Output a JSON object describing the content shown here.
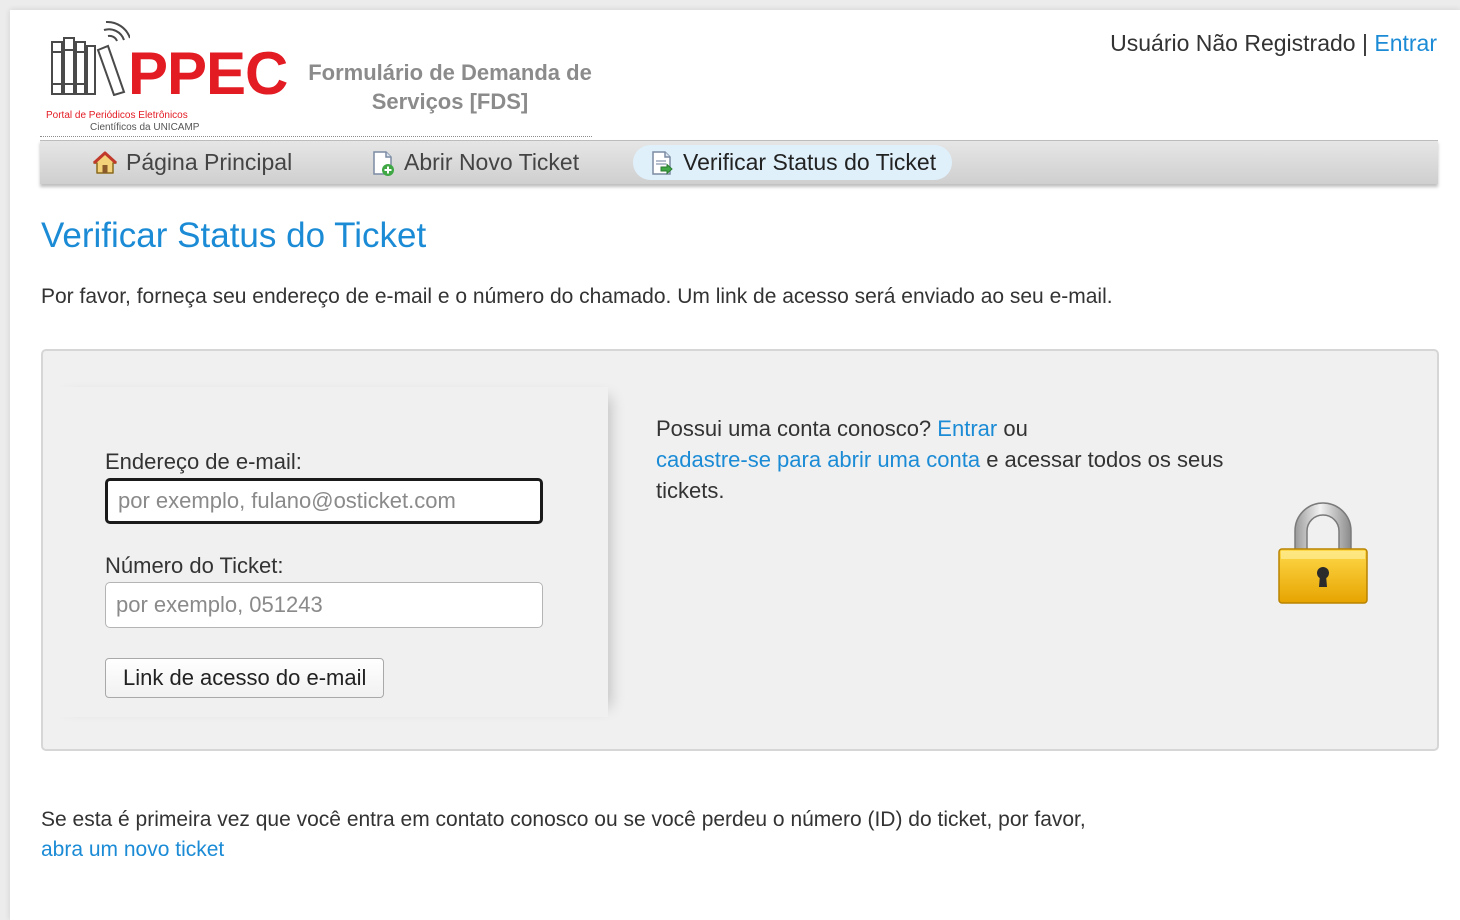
{
  "header": {
    "logo": {
      "wordmark": "PPEC",
      "tagline_line1": "Portal de Periódicos Eletrônicos",
      "tagline_line2": "Científicos da UNICAMP"
    },
    "subtitle": "Formulário de Demanda de Serviços [FDS]",
    "user_status": "Usuário Não Registrado",
    "separator": "|",
    "login_link": "Entrar"
  },
  "nav": {
    "items": [
      {
        "label": "Página Principal",
        "icon": "home-icon",
        "active": false
      },
      {
        "label": "Abrir Novo Ticket",
        "icon": "new-ticket-icon",
        "active": false
      },
      {
        "label": "Verificar Status do Ticket",
        "icon": "ticket-status-icon",
        "active": true
      }
    ]
  },
  "main": {
    "title": "Verificar Status do Ticket",
    "intro": "Por favor, forneça seu endereço de e-mail e o número do chamado. Um link de acesso será enviado ao seu e-mail.",
    "form": {
      "email_label": "Endereço de e-mail:",
      "email_placeholder": "por exemplo, fulano@osticket.com",
      "email_value": "",
      "ticket_label": "Número do Ticket:",
      "ticket_placeholder": "por exemplo, 051243",
      "ticket_value": "",
      "submit_label": "Link de acesso do e-mail"
    },
    "account": {
      "prefix": "Possui uma conta conosco?",
      "login_link": "Entrar",
      "middle": "ou",
      "register_link": "cadastre-se para abrir uma conta",
      "suffix": "e acessar todos os seus tickets.",
      "icon": "lock-icon"
    },
    "footer": {
      "text": "Se esta é primeira vez que você entra em contato conosco ou se você perdeu o número (ID) do ticket, por favor,",
      "link": "abra um novo ticket"
    }
  },
  "colors": {
    "accent": "#1b8bd6",
    "brand_red": "#e31b23",
    "active_tab": "#dff0fb",
    "panel_bg": "#f0f0f0"
  }
}
